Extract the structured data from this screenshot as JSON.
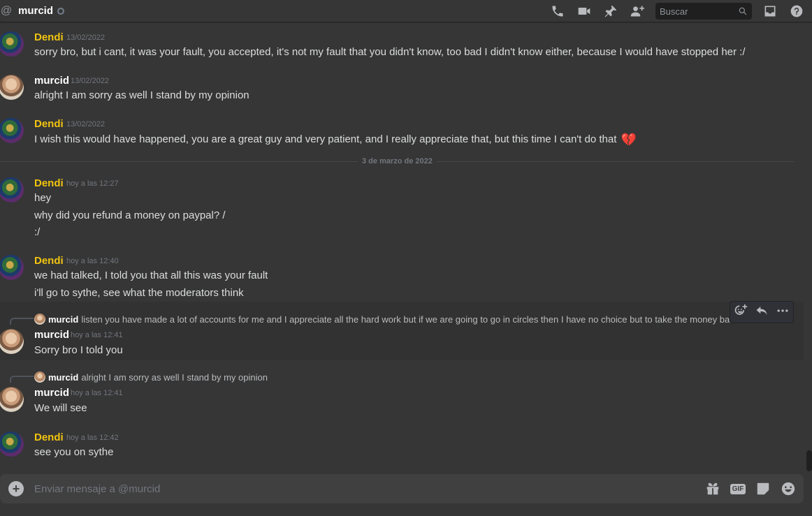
{
  "header": {
    "title": "murcid",
    "search_placeholder": "Buscar"
  },
  "messages": [
    {
      "author": "Dendi",
      "timestamp": "13/02/2022",
      "lines": [
        "sorry bro, but i cant, it was your fault, you accepted, it's not my fault that you didn't know, too bad I didn't know either, because I would have stopped her :/"
      ]
    },
    {
      "author": "murcid",
      "timestamp": "13/02/2022",
      "lines": [
        "alright I am sorry as well I stand by my opinion"
      ]
    },
    {
      "author": "Dendi",
      "timestamp": "13/02/2022",
      "lines": [
        "I wish this would have happened, you are a great guy and very patient, and I really appreciate that, but this time I can't do that"
      ]
    },
    {
      "author": "Dendi",
      "timestamp": "hoy a las 12:27",
      "lines": [
        "hey",
        "why did you refund a money on paypal? /",
        ":/"
      ]
    },
    {
      "author": "Dendi",
      "timestamp": "hoy a las 12:40",
      "lines": [
        "we had talked, I told you that all this was your fault",
        "i'll go to sythe, see what the moderators think"
      ]
    },
    {
      "author": "murcid",
      "timestamp": "hoy a las 12:41",
      "reply": {
        "author": "murcid",
        "text": "listen you have made a lot of accounts for me and I appreciate all the hard work but if we are going to go in circles then I have no choice but to take the money back"
      },
      "lines": [
        "Sorry bro I told you"
      ]
    },
    {
      "author": "murcid",
      "timestamp": "hoy a las 12:41",
      "reply": {
        "author": "murcid",
        "text": "alright I am sorry as well I stand by my opinion"
      },
      "lines": [
        "We will see"
      ]
    },
    {
      "author": "Dendi",
      "timestamp": "hoy a las 12:42",
      "lines": [
        "see you on sythe"
      ]
    }
  ],
  "divider": "3 de marzo de 2022",
  "composer": {
    "placeholder": "Enviar mensaje a @murcid",
    "gif_label": "GIF"
  },
  "icons": [
    "at-icon",
    "phone-icon",
    "video-icon",
    "pin-icon",
    "add-friend-icon",
    "search-icon",
    "inbox-icon",
    "help-icon",
    "add-reaction-icon",
    "reply-icon",
    "more-icon",
    "plus-icon",
    "gift-icon",
    "gif-icon",
    "sticker-icon",
    "emoji-icon",
    "broken-heart-icon"
  ],
  "colors": {
    "background": "#363636",
    "dendi_name": "#f1c40f",
    "text": "#dcddde",
    "muted": "#72767d"
  }
}
